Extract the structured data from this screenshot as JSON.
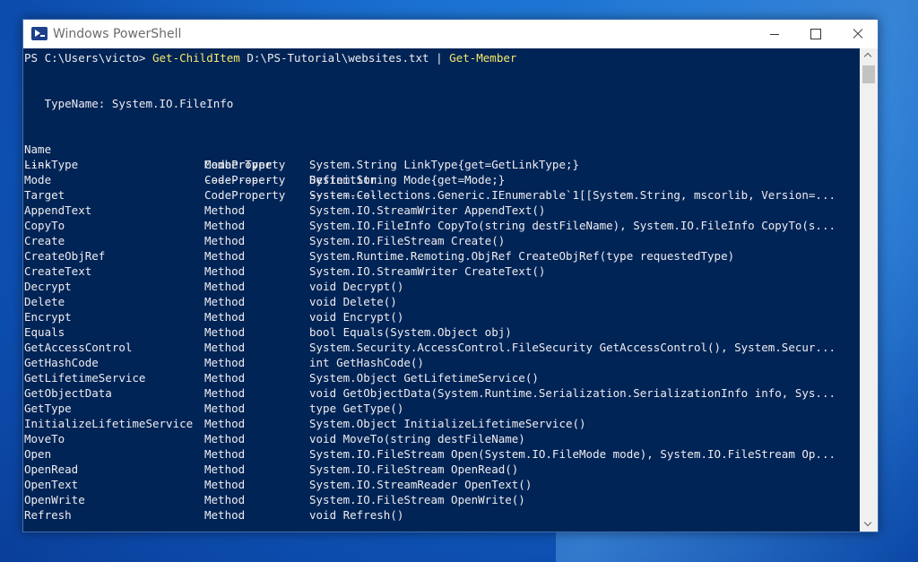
{
  "window": {
    "title": "Windows PowerShell"
  },
  "prompt": {
    "ps": "PS C:\\Users\\victo> ",
    "cmd1": "Get-ChildItem",
    "arg": " D:\\PS-Tutorial\\websites.txt | ",
    "cmd2": "Get-Member"
  },
  "typename_line": "   TypeName: System.IO.FileInfo",
  "header": {
    "name": "Name",
    "type": "MemberType",
    "def": "Definition"
  },
  "separator": {
    "name": "----",
    "type": "----------",
    "def": "----------"
  },
  "rows": [
    {
      "name": "LinkType",
      "type": "CodeProperty",
      "def": "System.String LinkType{get=GetLinkType;}"
    },
    {
      "name": "Mode",
      "type": "CodeProperty",
      "def": "System.String Mode{get=Mode;}"
    },
    {
      "name": "Target",
      "type": "CodeProperty",
      "def": "System.Collections.Generic.IEnumerable`1[[System.String, mscorlib, Version=..."
    },
    {
      "name": "AppendText",
      "type": "Method",
      "def": "System.IO.StreamWriter AppendText()"
    },
    {
      "name": "CopyTo",
      "type": "Method",
      "def": "System.IO.FileInfo CopyTo(string destFileName), System.IO.FileInfo CopyTo(s..."
    },
    {
      "name": "Create",
      "type": "Method",
      "def": "System.IO.FileStream Create()"
    },
    {
      "name": "CreateObjRef",
      "type": "Method",
      "def": "System.Runtime.Remoting.ObjRef CreateObjRef(type requestedType)"
    },
    {
      "name": "CreateText",
      "type": "Method",
      "def": "System.IO.StreamWriter CreateText()"
    },
    {
      "name": "Decrypt",
      "type": "Method",
      "def": "void Decrypt()"
    },
    {
      "name": "Delete",
      "type": "Method",
      "def": "void Delete()"
    },
    {
      "name": "Encrypt",
      "type": "Method",
      "def": "void Encrypt()"
    },
    {
      "name": "Equals",
      "type": "Method",
      "def": "bool Equals(System.Object obj)"
    },
    {
      "name": "GetAccessControl",
      "type": "Method",
      "def": "System.Security.AccessControl.FileSecurity GetAccessControl(), System.Secur..."
    },
    {
      "name": "GetHashCode",
      "type": "Method",
      "def": "int GetHashCode()"
    },
    {
      "name": "GetLifetimeService",
      "type": "Method",
      "def": "System.Object GetLifetimeService()"
    },
    {
      "name": "GetObjectData",
      "type": "Method",
      "def": "void GetObjectData(System.Runtime.Serialization.SerializationInfo info, Sys..."
    },
    {
      "name": "GetType",
      "type": "Method",
      "def": "type GetType()"
    },
    {
      "name": "InitializeLifetimeService",
      "type": "Method",
      "def": "System.Object InitializeLifetimeService()"
    },
    {
      "name": "MoveTo",
      "type": "Method",
      "def": "void MoveTo(string destFileName)"
    },
    {
      "name": "Open",
      "type": "Method",
      "def": "System.IO.FileStream Open(System.IO.FileMode mode), System.IO.FileStream Op..."
    },
    {
      "name": "OpenRead",
      "type": "Method",
      "def": "System.IO.FileStream OpenRead()"
    },
    {
      "name": "OpenText",
      "type": "Method",
      "def": "System.IO.StreamReader OpenText()"
    },
    {
      "name": "OpenWrite",
      "type": "Method",
      "def": "System.IO.FileStream OpenWrite()"
    },
    {
      "name": "Refresh",
      "type": "Method",
      "def": "void Refresh()"
    }
  ],
  "colors": {
    "console_bg": "#012456",
    "console_fg": "#eeedf0",
    "command_yellow": "#f5e86b"
  },
  "icons": {
    "app": "powershell-icon",
    "minimize": "minimize-icon",
    "maximize": "maximize-icon",
    "close": "close-icon"
  }
}
